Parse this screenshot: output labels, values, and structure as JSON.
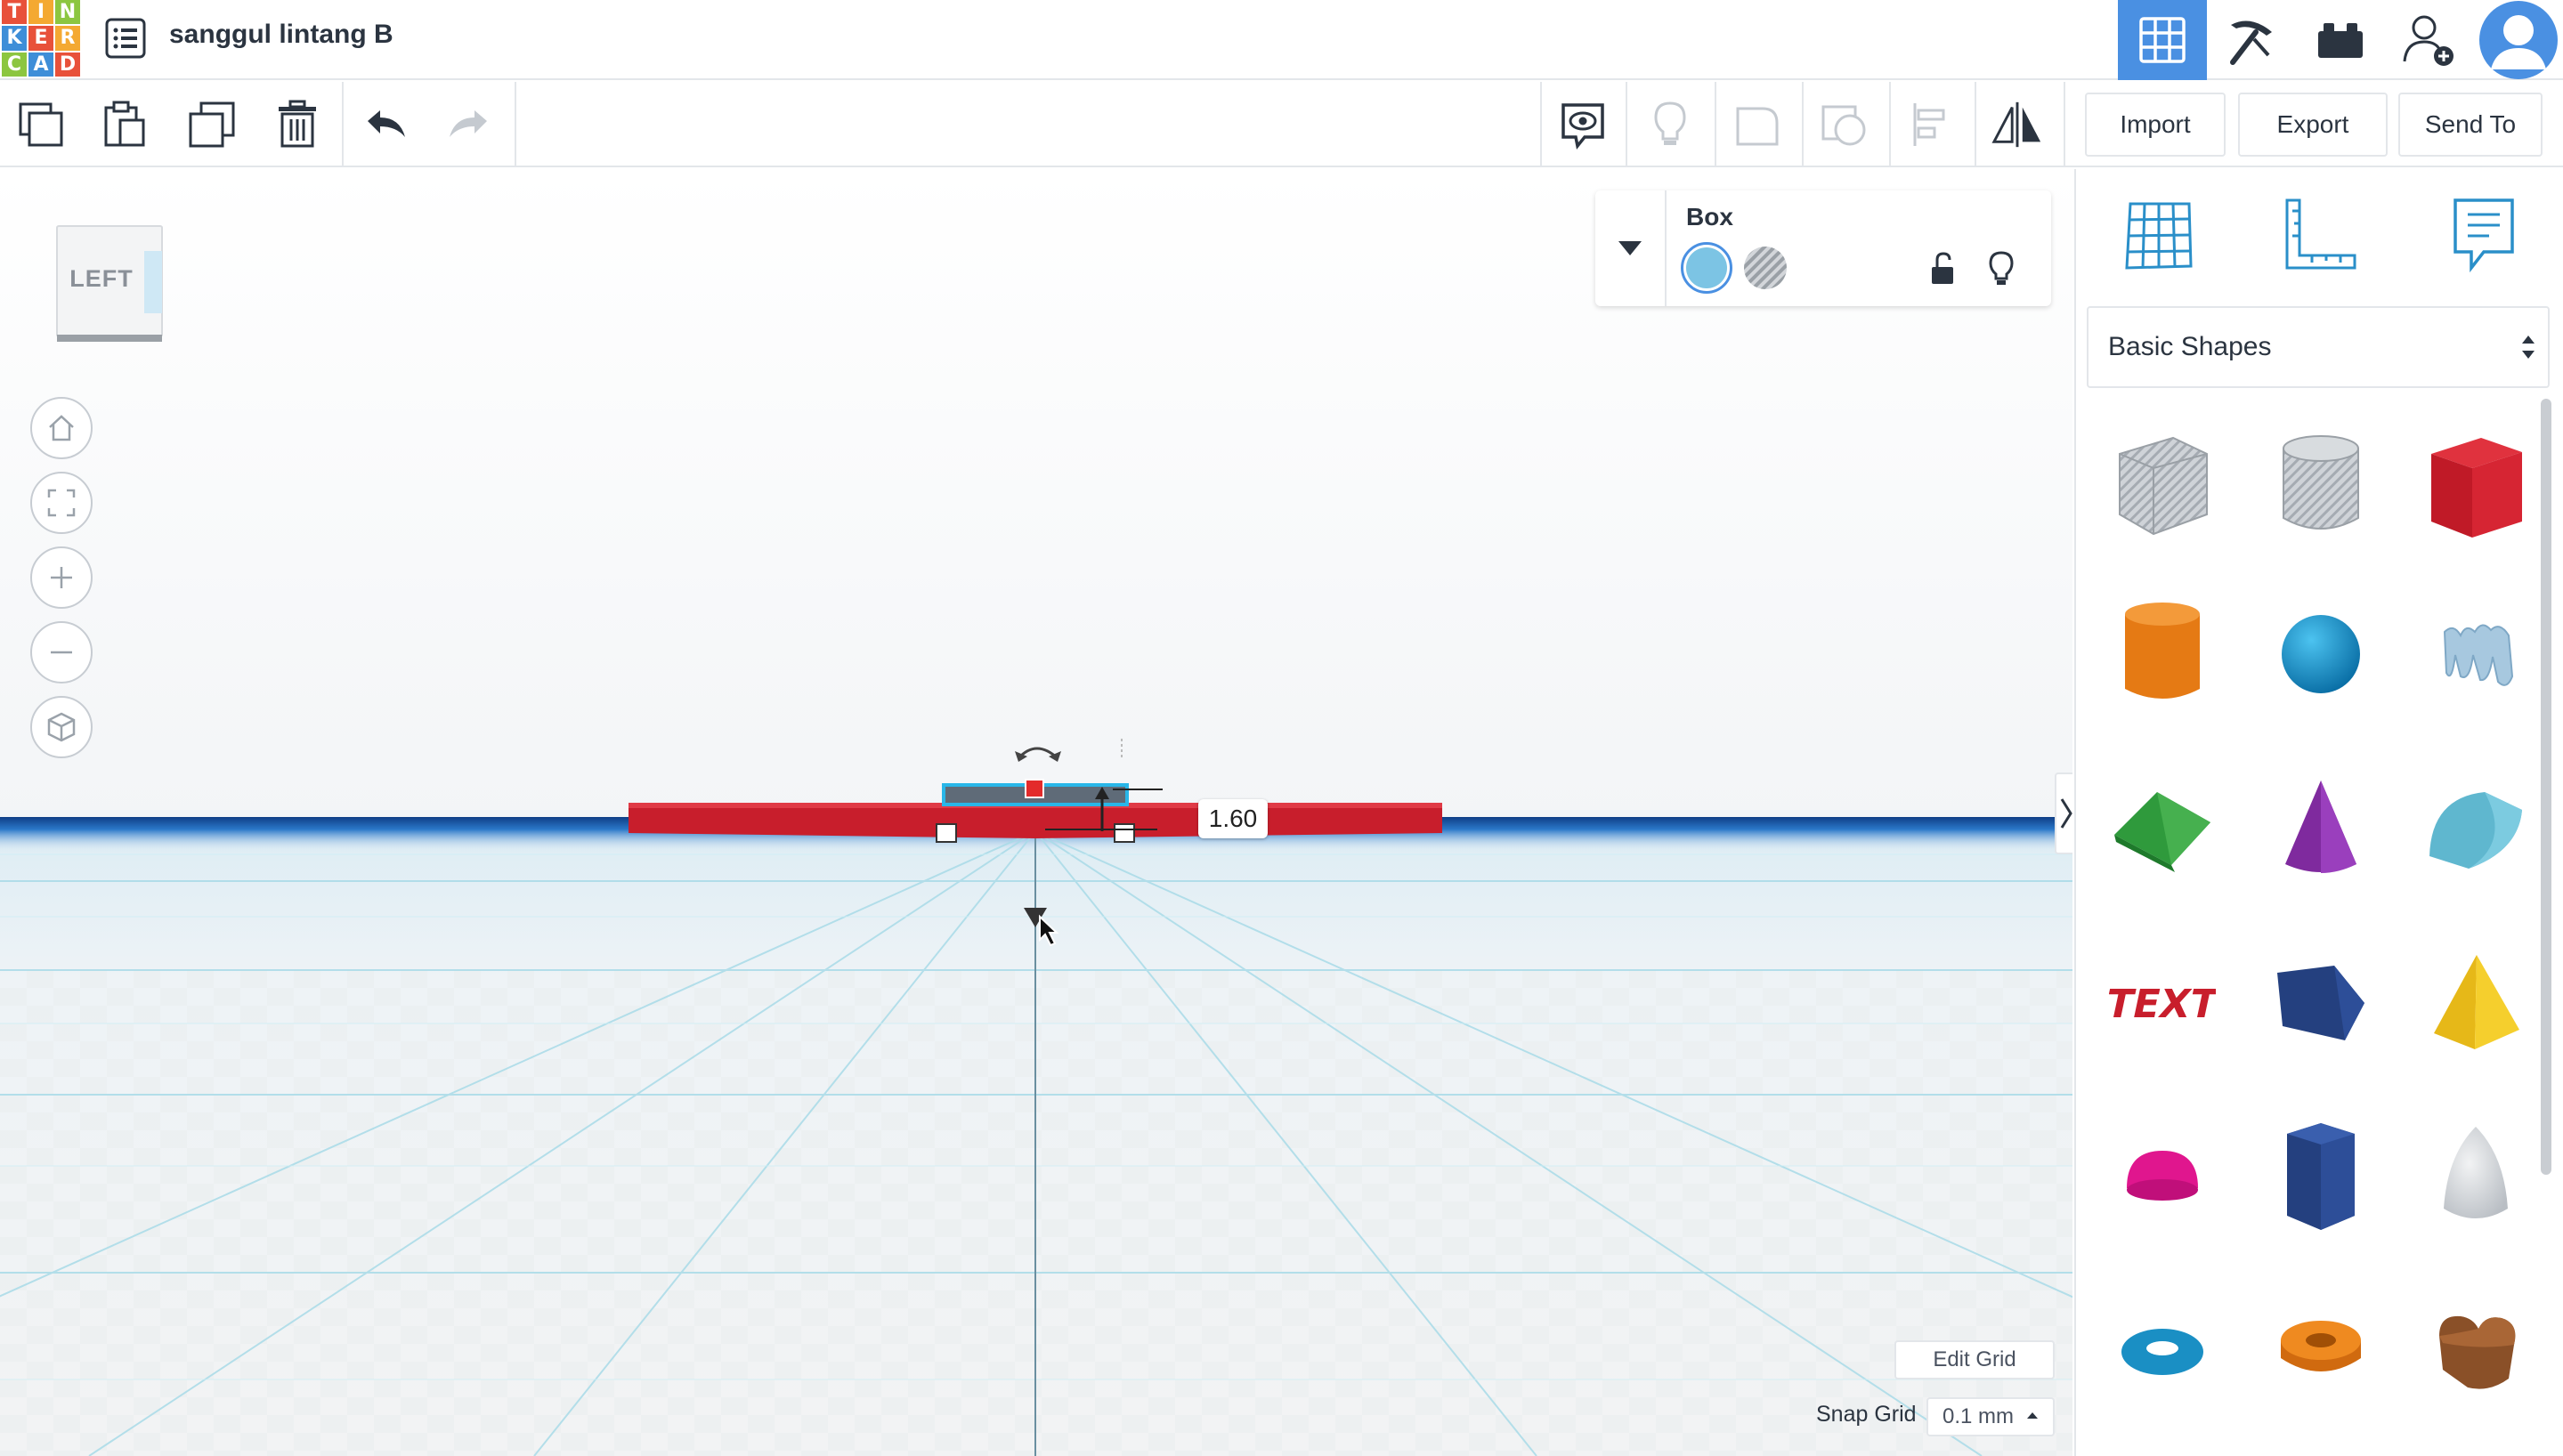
{
  "app": {
    "logo_letters": [
      "T",
      "I",
      "N",
      "K",
      "E",
      "R",
      "C",
      "A",
      "D"
    ],
    "logo_colors": [
      "#e8513a",
      "#f4a932",
      "#8cc640",
      "#3e8ed8",
      "#e8513a",
      "#f4a932",
      "#8cc640",
      "#3e8ed8",
      "#e8513a"
    ],
    "project_title": "sanggul lintang B"
  },
  "header": {
    "buttons": [
      "3d-design-view",
      "codeblocks-view",
      "bricks-view",
      "invite-user",
      "user-avatar"
    ]
  },
  "toolbar": {
    "import_label": "Import",
    "export_label": "Export",
    "send_to_label": "Send To"
  },
  "viewcube": {
    "face_label": "LEFT"
  },
  "workplane": {
    "dimension_value": "1.60",
    "edit_grid_label": "Edit Grid",
    "snap_grid_label": "Snap Grid",
    "snap_grid_value": "0.1 mm"
  },
  "inspector": {
    "shape_name": "Box",
    "solid_color": "#7cc4e4"
  },
  "library": {
    "category": "Basic Shapes",
    "shapes": [
      "box-hole",
      "cylinder-hole",
      "box",
      "cylinder",
      "sphere",
      "scribble",
      "roof",
      "cone",
      "round-roof",
      "text",
      "wedge",
      "pyramid",
      "half-sphere",
      "polygon",
      "paraboloid",
      "torus",
      "tube",
      "heart"
    ]
  },
  "colors": {
    "accent": "#4a90e2",
    "box_red": "#d0202e",
    "workplane_blue": "#1f5aa8"
  }
}
